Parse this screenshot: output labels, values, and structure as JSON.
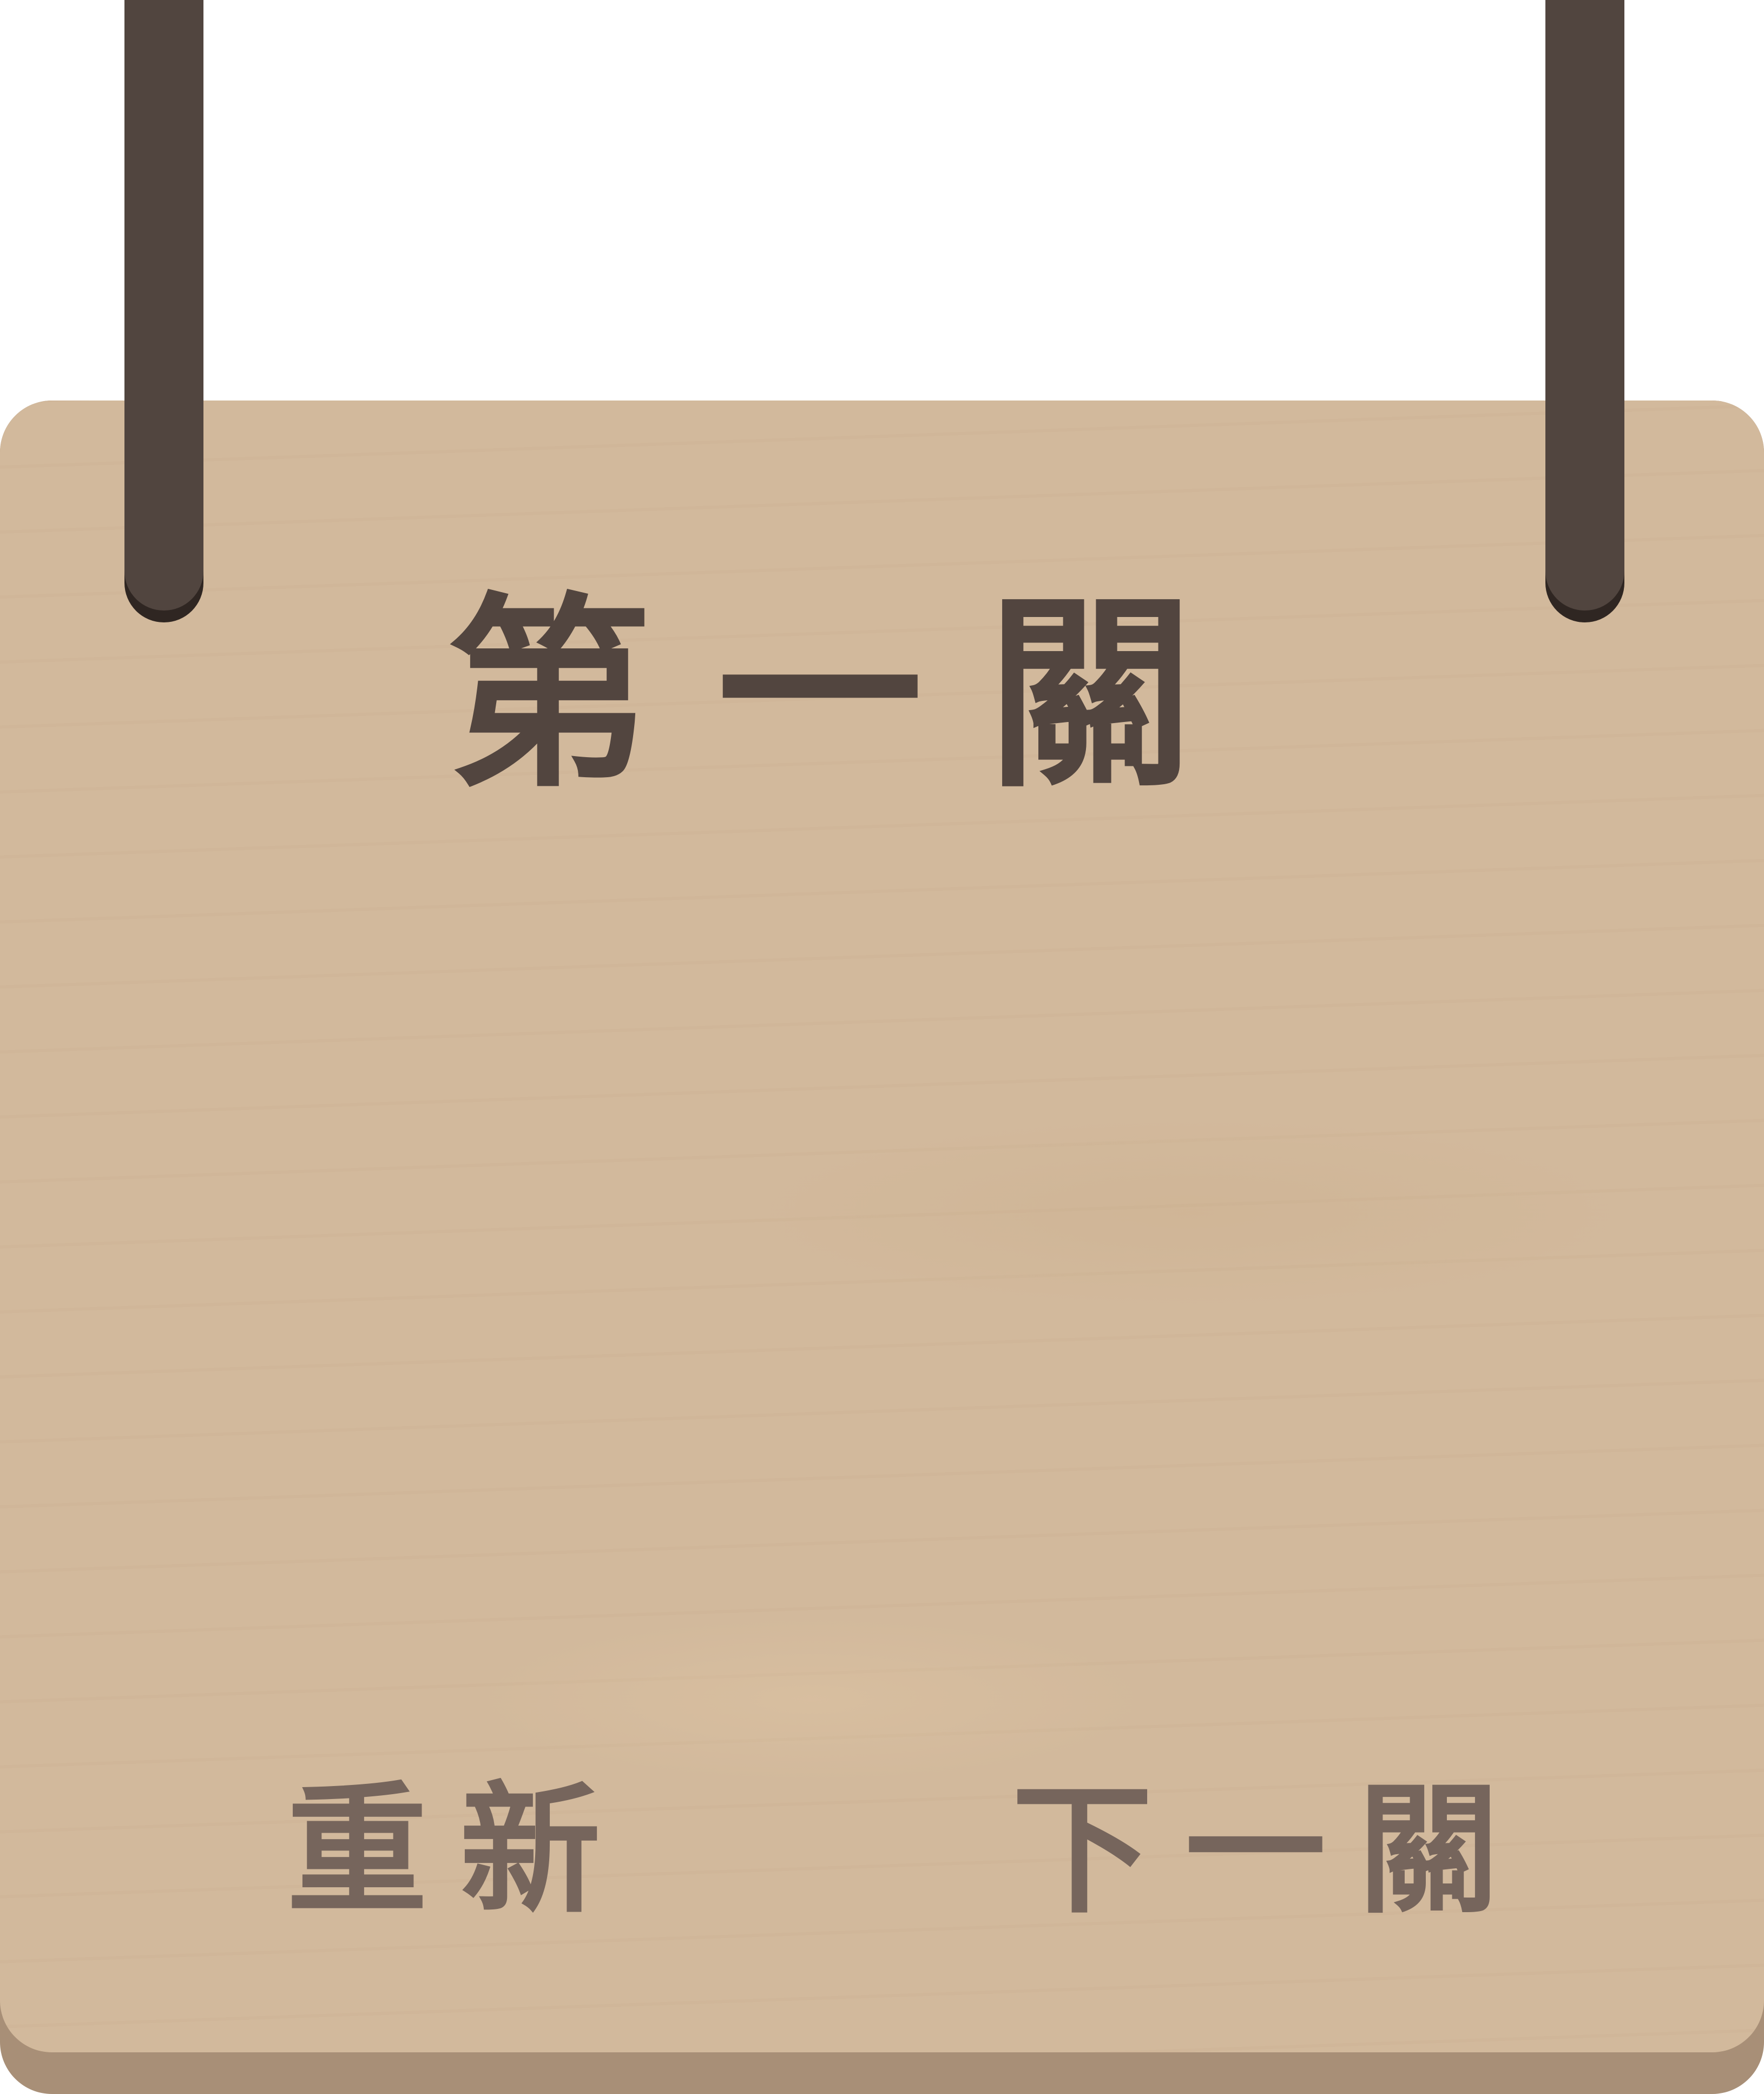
{
  "level": {
    "title": "第一關"
  },
  "buttons": {
    "restart_label": "重新",
    "next_label": "下一關"
  },
  "colors": {
    "board": "#d2b99c",
    "board_edge": "#a88f77",
    "rope": "#51453f",
    "title_text": "#52453f",
    "button_text": "#76655c"
  }
}
